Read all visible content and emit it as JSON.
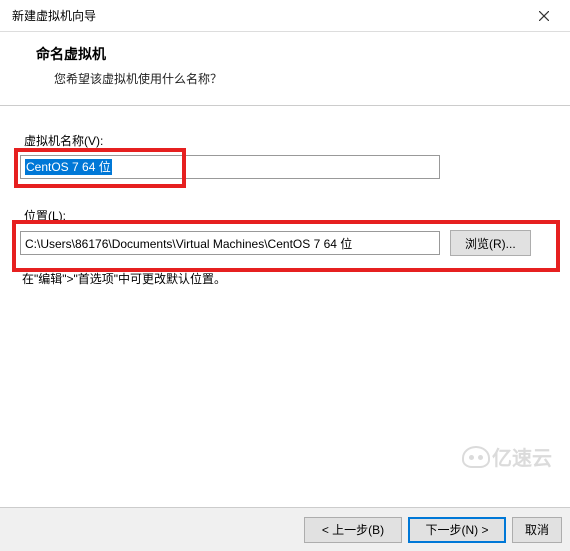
{
  "window": {
    "title": "新建虚拟机向导"
  },
  "header": {
    "title": "命名虚拟机",
    "subtitle": "您希望该虚拟机使用什么名称？"
  },
  "fields": {
    "vm_name_label": "虚拟机名称(V):",
    "vm_name_value": "CentOS 7 64 位",
    "location_label": "位置(L):",
    "location_value": "C:\\Users\\86176\\Documents\\Virtual Machines\\CentOS 7 64 位",
    "browse_label": "浏览(R)..."
  },
  "hint": "在\"编辑\">\"首选项\"中可更改默认位置。",
  "footer": {
    "back": "< 上一步(B)",
    "next": "下一步(N) >",
    "cancel": "取消"
  },
  "watermark": "亿速云"
}
